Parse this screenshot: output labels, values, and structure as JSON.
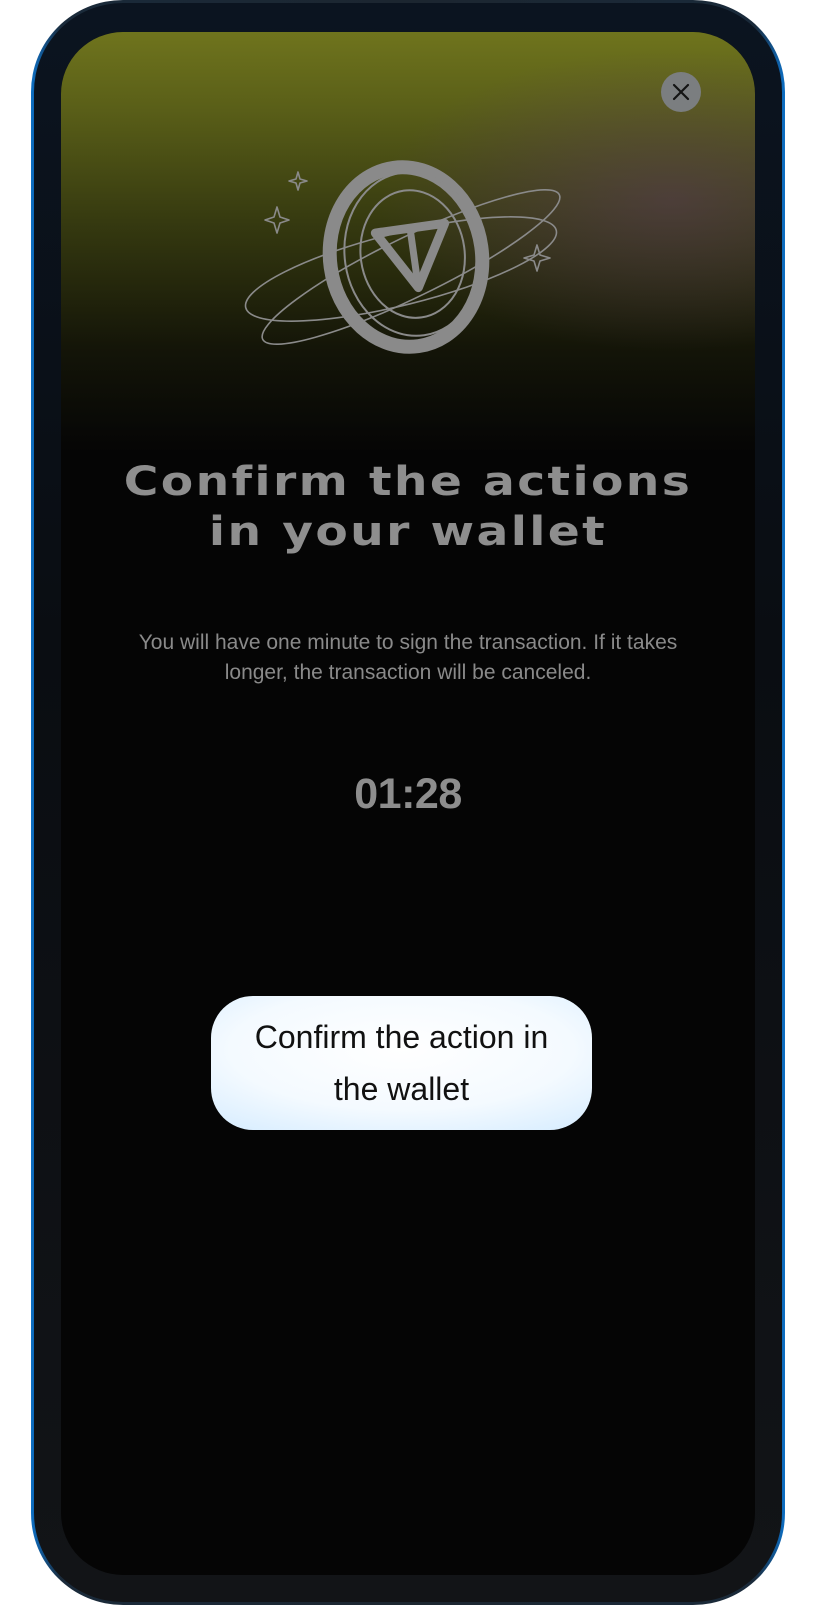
{
  "modal": {
    "close_icon": "close-icon",
    "hero_icon": "ton-coin-illustration",
    "title": "Confirm the actions in your wallet",
    "subtitle": "You will have one minute to sign the transaction. If it takes longer, the transaction will be canceled.",
    "timer": "01:28",
    "confirm_button_label": "Confirm the action in the wallet"
  },
  "colors": {
    "background": "#050505",
    "glow_top": "#6f741d",
    "text_muted": "#8e8e8e",
    "button_light": "#b6dcff"
  }
}
